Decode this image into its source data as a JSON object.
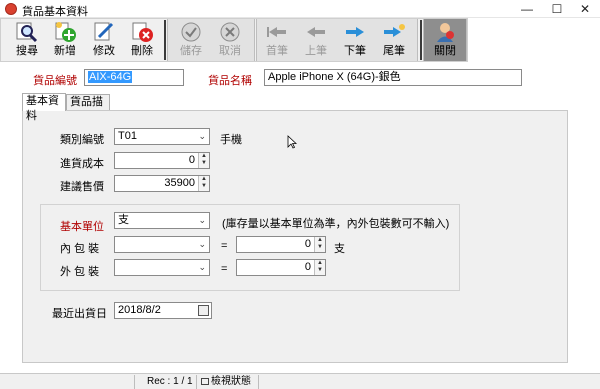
{
  "window": {
    "title": "貨品基本資料",
    "minimize": "—",
    "maximize": "☐",
    "close": "✕"
  },
  "toolbar": {
    "search": "搜尋",
    "add": "新增",
    "edit": "修改",
    "delete": "刪除",
    "save": "儲存",
    "cancel": "取消",
    "first": "首筆",
    "prev": "上筆",
    "next": "下筆",
    "last": "尾筆",
    "close": "關閉"
  },
  "header": {
    "code_label": "貨品編號",
    "code_value": "AIX-64G",
    "name_label": "貨品名稱",
    "name_value": "Apple iPhone X (64G)-銀色"
  },
  "tabs": [
    "基本資料",
    "貨品描述"
  ],
  "basic": {
    "category_label": "類別編號",
    "category_value": "T01",
    "category_name": "手機",
    "cost_label": "進貨成本",
    "cost_value": "0",
    "price_label": "建議售價",
    "price_value": "35900",
    "unit_label": "基本單位",
    "unit_value": "支",
    "unit_note": "(庫存量以基本單位為準，內外包裝數可不輸入)",
    "inner_label": "內 包 裝",
    "inner_qty": "0",
    "inner_unit": "支",
    "outer_label": "外 包 裝",
    "outer_qty": "0",
    "equals": "=",
    "last_date_label": "最近出貨日",
    "last_date_value": "2018/8/2"
  },
  "status": {
    "rec": "Rec : 1 / 1",
    "mode": "檢視狀態"
  },
  "colors": {
    "accent_red": "#b00000",
    "selection": "#3399ff"
  }
}
